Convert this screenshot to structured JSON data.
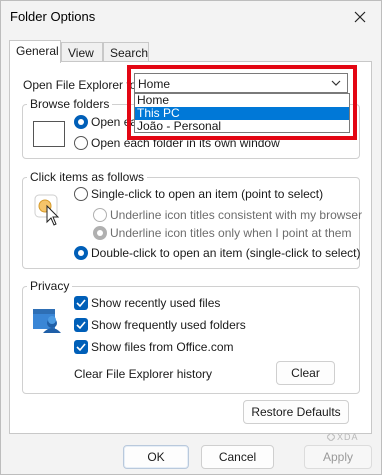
{
  "window": {
    "title": "Folder Options"
  },
  "tabs": [
    {
      "label": "General",
      "active": true
    },
    {
      "label": "View",
      "active": false
    },
    {
      "label": "Search",
      "active": false
    }
  ],
  "open_explorer": {
    "label": "Open File Explorer to:",
    "selected": "Home",
    "options": [
      "Home",
      "This PC",
      "João - Personal"
    ],
    "highlighted_option": "This PC"
  },
  "browse_folders": {
    "legend": "Browse folders",
    "option_same_window": "Open each folder in the same window",
    "option_own_window": "Open each folder in its own window"
  },
  "click_items": {
    "legend": "Click items as follows",
    "single_click": "Single-click to open an item (point to select)",
    "underline_consistent": "Underline icon titles consistent with my browser",
    "underline_point": "Underline icon titles only when I point at them",
    "double_click": "Double-click to open an item (single-click to select)"
  },
  "privacy": {
    "legend": "Privacy",
    "show_recent_files": "Show recently used files",
    "show_frequent_folders": "Show frequently used folders",
    "show_office": "Show files from Office.com",
    "clear_history_label": "Clear File Explorer history",
    "clear_button": "Clear"
  },
  "restore_defaults": "Restore Defaults",
  "footer": {
    "ok": "OK",
    "cancel": "Cancel",
    "apply": "Apply"
  },
  "watermark": "XDA",
  "colors": {
    "accent": "#005fb8",
    "highlight_frame": "#e30613",
    "selection": "#0078d7"
  }
}
